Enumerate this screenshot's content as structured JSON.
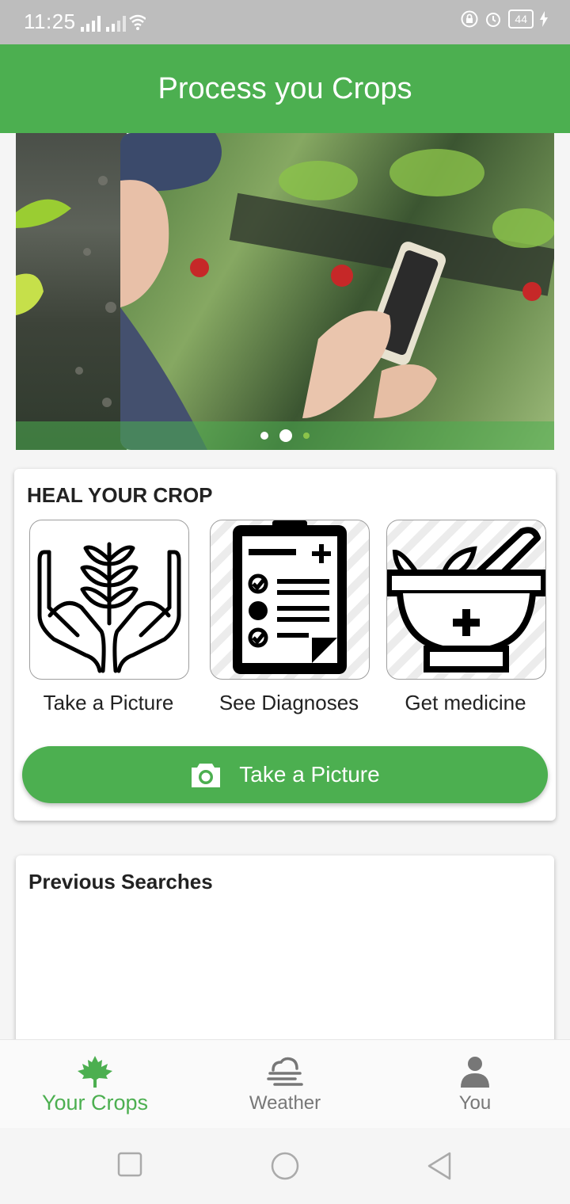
{
  "status_bar": {
    "time": "11:25",
    "battery": "44"
  },
  "app_bar": {
    "title": "Process you Crops"
  },
  "carousel": {
    "slides": 3,
    "active_index": 1
  },
  "heal": {
    "title": "HEAL YOUR CROP",
    "steps": [
      {
        "label": "Take a Picture",
        "icon": "hands-plant-icon"
      },
      {
        "label": "See Diagnoses",
        "icon": "clipboard-checklist-icon"
      },
      {
        "label": "Get medicine",
        "icon": "mortar-pestle-icon"
      }
    ],
    "button_label": "Take a Picture",
    "button_icon": "camera-icon"
  },
  "previous": {
    "title": "Previous Searches"
  },
  "bottom_nav": {
    "items": [
      {
        "label": "Your Crops",
        "icon": "maple-leaf-icon",
        "active": true
      },
      {
        "label": "Weather",
        "icon": "fog-cloud-icon",
        "active": false
      },
      {
        "label": "You",
        "icon": "person-icon",
        "active": false
      }
    ]
  },
  "colors": {
    "primary": "#4caf50",
    "status_bar": "#bdbdbd",
    "text": "#222222",
    "inactive": "#777777"
  }
}
